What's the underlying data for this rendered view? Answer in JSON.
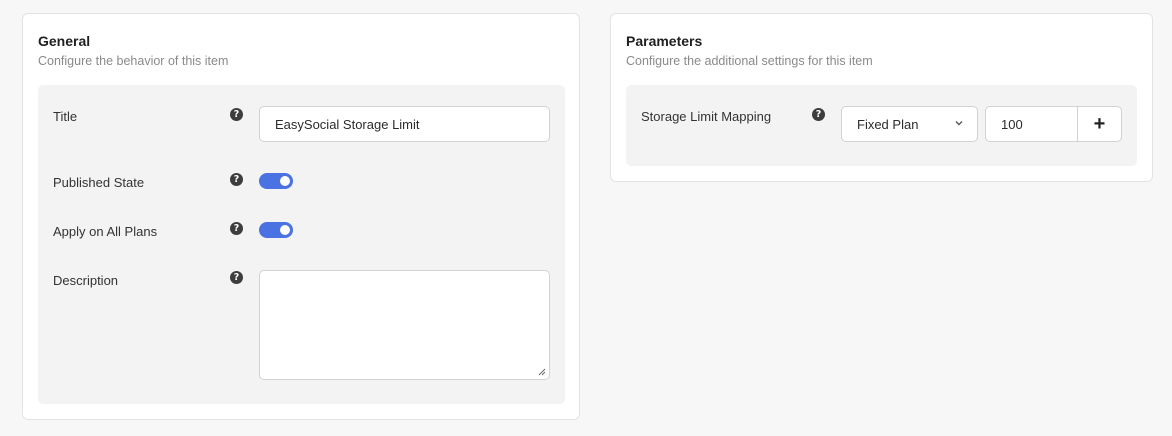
{
  "general": {
    "title": "General",
    "subtitle": "Configure the behavior of this item",
    "fields": {
      "title_label": "Title",
      "title_value": "EasySocial Storage Limit",
      "published_label": "Published State",
      "published_on": true,
      "apply_all_label": "Apply on All Plans",
      "apply_all_on": true,
      "description_label": "Description",
      "description_value": ""
    }
  },
  "parameters": {
    "title": "Parameters",
    "subtitle": "Configure the additional settings for this item",
    "storage_label": "Storage Limit Mapping",
    "plan_select_value": "Fixed Plan",
    "limit_value": "100",
    "add_label": "+"
  },
  "colors": {
    "accent": "#4a72e2",
    "panel_bg": "#ffffff",
    "inner_bg": "#f3f3f3",
    "page_bg": "#f7f7f7"
  },
  "icons": {
    "help": "question-circle-icon",
    "chevron": "chevron-down-icon",
    "resize": "resize-grip-icon"
  }
}
